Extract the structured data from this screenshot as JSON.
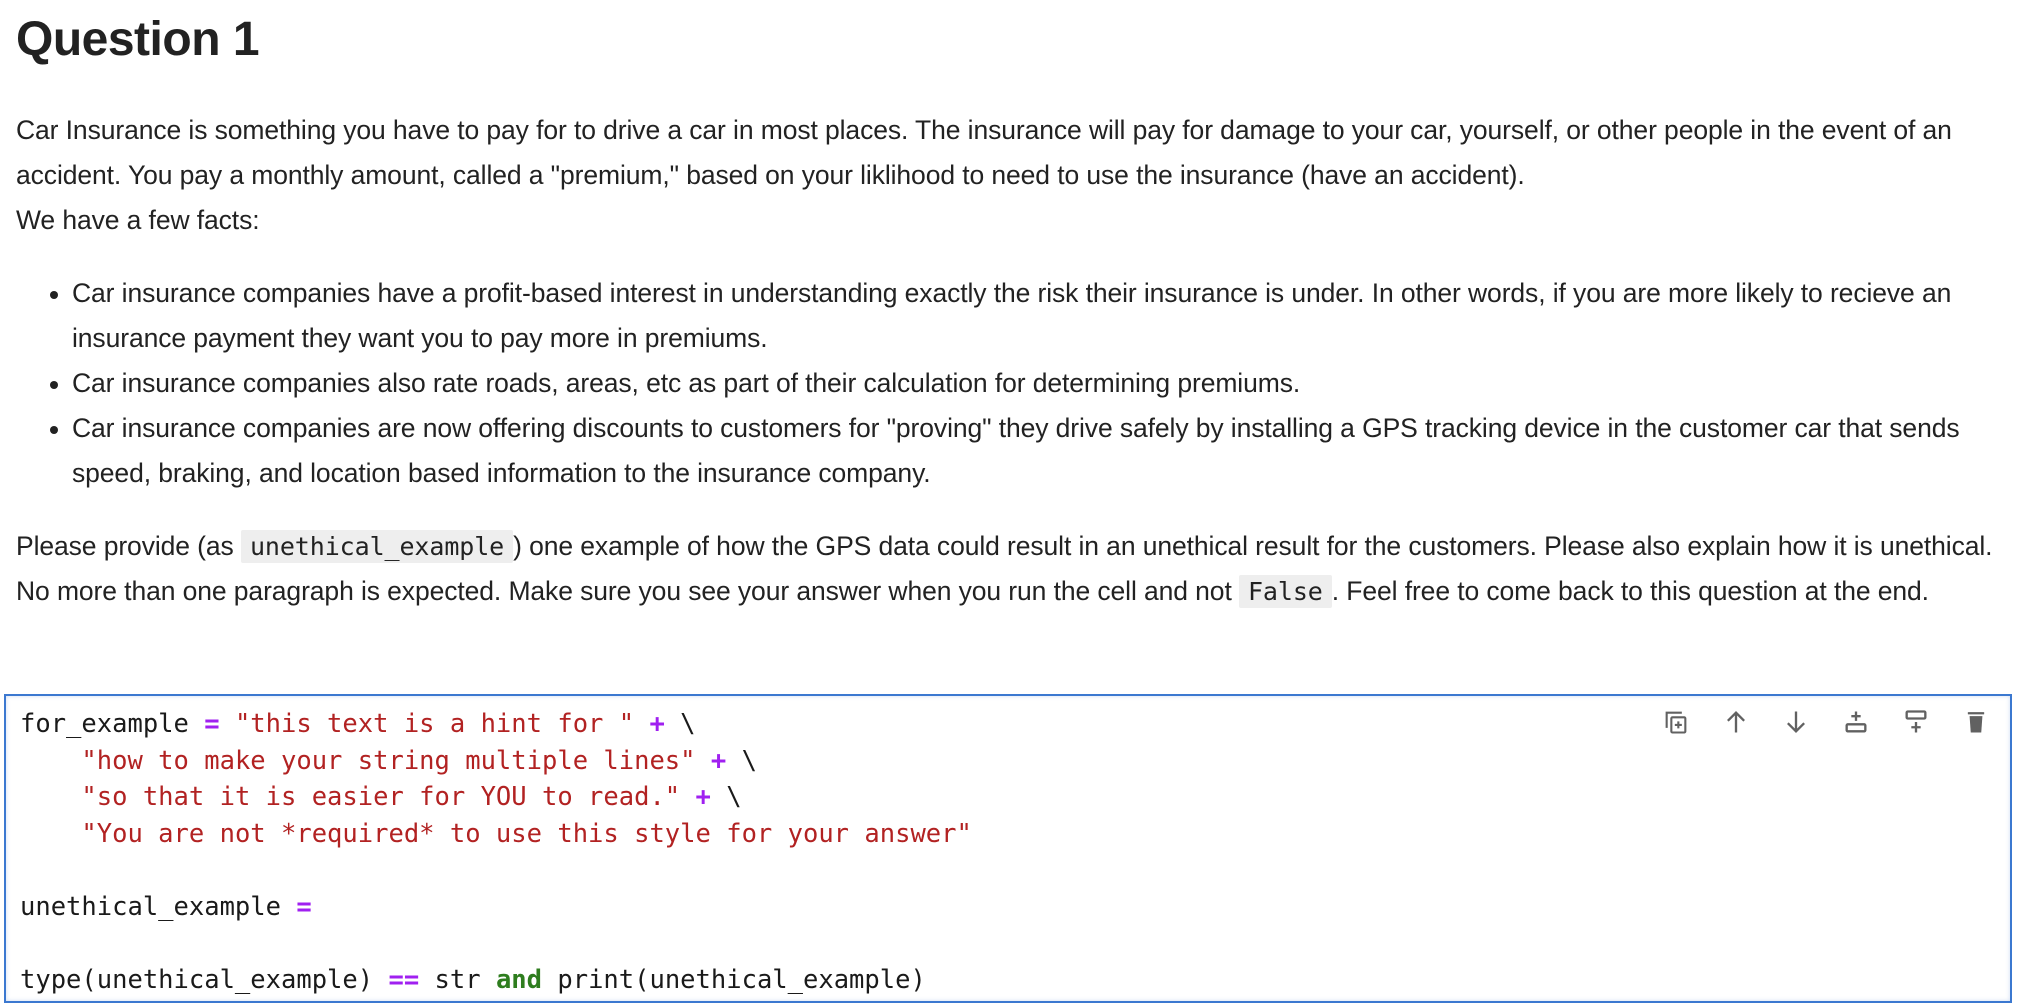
{
  "markdown": {
    "title": "Question 1",
    "intro_lines": [
      "Car Insurance is something you have to pay for to drive a car in most places. The insurance will pay for damage to your car, yourself, or other people in the event of an accident. You pay a monthly amount, called a \"premium,\" based on your liklihood to need to use the insurance (have an accident).",
      "We have a few facts:"
    ],
    "facts": [
      "Car insurance companies have a profit-based interest in understanding exactly the risk their insurance is under. In other words, if you are more likely to recieve an insurance payment they want you to pay more in premiums.",
      "Car insurance companies also rate roads, areas, etc as part of their calculation for determining premiums.",
      "Car insurance companies are now offering discounts to customers for \"proving\" they drive safely by installing a GPS tracking device in the customer car that sends speed, braking, and location based information to the insurance company."
    ],
    "instructions": {
      "part1": "Please provide (as ",
      "code1": "unethical_example",
      "part2": ") one example of how the GPS data could result in an unethical result for the customers. Please also explain how it is unethical. No more than one paragraph is expected. Make sure you see your answer when you run the cell and not ",
      "code2": "False",
      "part3": ". Feel free to come back to this question at the end."
    }
  },
  "code_cell": {
    "lines": [
      [
        [
          "id",
          "for_example "
        ],
        [
          "op",
          "="
        ],
        [
          "str",
          " \"this text is a hint for \""
        ],
        [
          "id",
          " "
        ],
        [
          "op",
          "+"
        ],
        [
          "id",
          " \\"
        ]
      ],
      [
        [
          "id",
          "    "
        ],
        [
          "str",
          "\"how to make your string multiple lines\""
        ],
        [
          "id",
          " "
        ],
        [
          "op",
          "+"
        ],
        [
          "id",
          " \\"
        ]
      ],
      [
        [
          "id",
          "    "
        ],
        [
          "str",
          "\"so that it is easier for YOU to read.\""
        ],
        [
          "id",
          " "
        ],
        [
          "op",
          "+"
        ],
        [
          "id",
          " \\"
        ]
      ],
      [
        [
          "id",
          "    "
        ],
        [
          "str",
          "\"You are not *required* to use this style for your answer\""
        ]
      ],
      [],
      [
        [
          "id",
          "unethical_example "
        ],
        [
          "op",
          "="
        ]
      ],
      [],
      [
        [
          "id",
          "type(unethical_example) "
        ],
        [
          "op",
          "=="
        ],
        [
          "id",
          " str "
        ],
        [
          "kw",
          "and"
        ],
        [
          "id",
          " print(unethical_example)"
        ]
      ]
    ],
    "toolbar": [
      {
        "name": "duplicate-cell-button",
        "icon": "duplicate-icon",
        "title": "Create a duplicate of this cell below"
      },
      {
        "name": "move-up-button",
        "icon": "arrow-up-icon",
        "title": "Move this cell up"
      },
      {
        "name": "move-down-button",
        "icon": "arrow-down-icon",
        "title": "Move this cell down"
      },
      {
        "name": "insert-above-button",
        "icon": "insert-above-icon",
        "title": "Insert a cell above"
      },
      {
        "name": "insert-below-button",
        "icon": "insert-below-icon",
        "title": "Insert a cell below"
      },
      {
        "name": "delete-cell-button",
        "icon": "trash-icon",
        "title": "Delete this cell"
      }
    ]
  },
  "colors": {
    "cell_border": "#3b78d0",
    "string": "#b22222",
    "operator": "#a020f0",
    "keyword": "#2e7d1e",
    "text": "#222222",
    "inline_code_bg": "#eeeeee"
  }
}
